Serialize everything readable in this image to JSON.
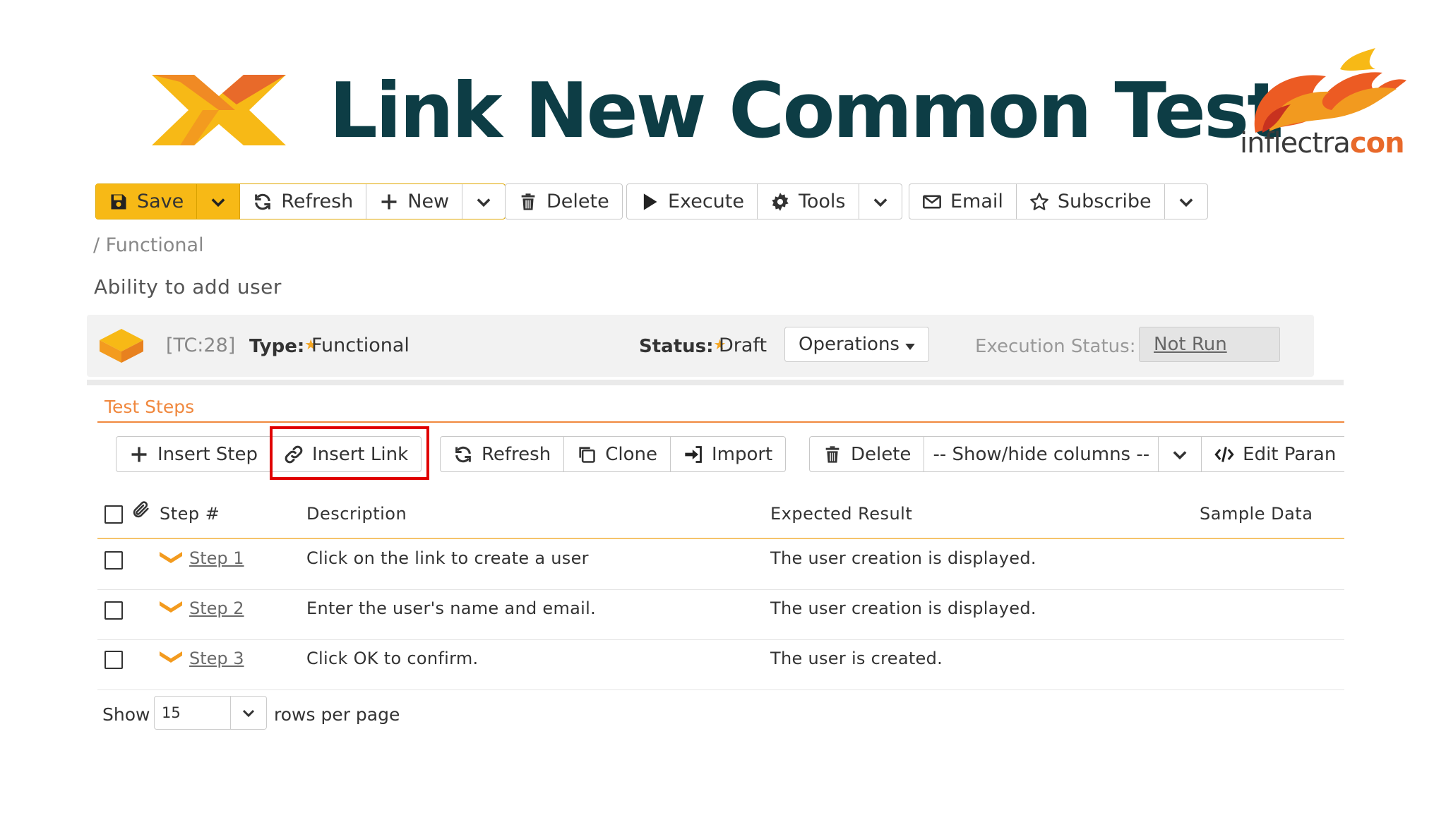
{
  "header": {
    "title": "Link New Common Test",
    "brand_prefix": "inflectra",
    "brand_suffix": "con"
  },
  "toolbar": {
    "save": "Save",
    "refresh": "Refresh",
    "new": "New",
    "delete": "Delete",
    "execute": "Execute",
    "tools": "Tools",
    "email": "Email",
    "subscribe": "Subscribe"
  },
  "breadcrumb": "/ Functional",
  "test_case": {
    "name": "Ability to add user",
    "id": "[TC:28]",
    "type_label": "Type:",
    "type_value": "Functional",
    "status_label": "Status:",
    "status_value": "Draft",
    "operations": "Operations",
    "execution_status_label": "Execution Status:",
    "execution_status_value": "Not Run"
  },
  "steps_section": {
    "title": "Test Steps",
    "toolbar": {
      "insert_step": "Insert Step",
      "insert_link": "Insert Link",
      "refresh": "Refresh",
      "clone": "Clone",
      "import": "Import",
      "delete": "Delete",
      "show_hide": "-- Show/hide columns --",
      "edit_params": "Edit Paran"
    },
    "columns": [
      "Step #",
      "Description",
      "Expected Result",
      "Sample Data"
    ],
    "rows": [
      {
        "step": "Step 1",
        "description": "Click on the link to create a user",
        "expected": "The user creation is displayed.",
        "sample": ""
      },
      {
        "step": "Step 2",
        "description": "Enter the user's name and email.",
        "expected": "The user creation is displayed.",
        "sample": ""
      },
      {
        "step": "Step 3",
        "description": "Click OK to confirm.",
        "expected": "The user is created.",
        "sample": ""
      }
    ]
  },
  "pagination": {
    "show_label": "Show",
    "page_size": "15",
    "rows_label": "rows per page"
  },
  "colors": {
    "accent_orange": "#f0883e",
    "save_yellow": "#f7b916",
    "title_teal": "#0d3d45",
    "highlight_red": "#e00000"
  }
}
